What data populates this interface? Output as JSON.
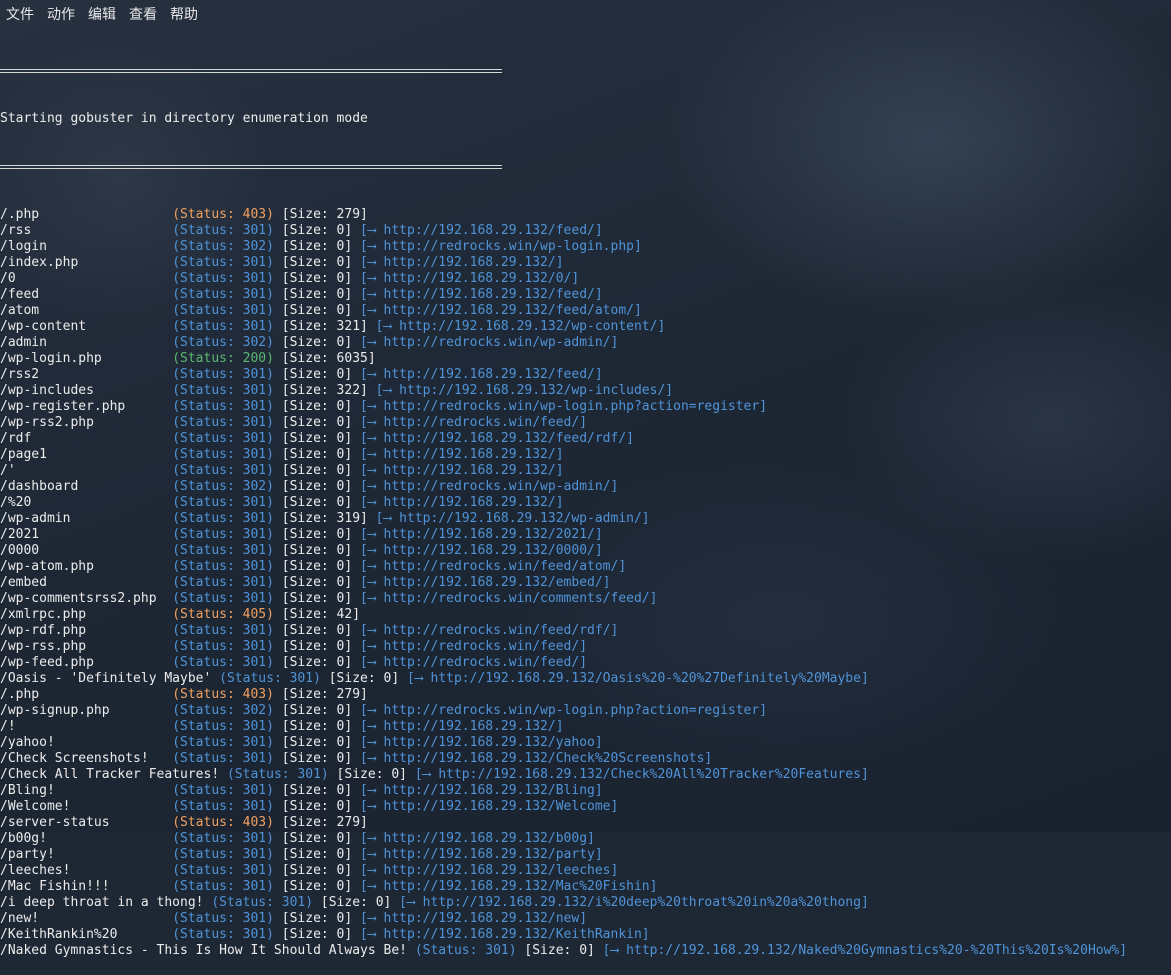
{
  "menubar": [
    "文件",
    "动作",
    "编辑",
    "查看",
    "帮助"
  ],
  "banner": "Starting gobuster in directory enumeration mode",
  "rows": [
    {
      "path": "/.php",
      "status": "403",
      "size": "279",
      "redirect": ""
    },
    {
      "path": "/rss",
      "status": "301",
      "size": "0",
      "redirect": "http://192.168.29.132/feed/"
    },
    {
      "path": "/login",
      "status": "302",
      "size": "0",
      "redirect": "http://redrocks.win/wp-login.php"
    },
    {
      "path": "/index.php",
      "status": "301",
      "size": "0",
      "redirect": "http://192.168.29.132/"
    },
    {
      "path": "/0",
      "status": "301",
      "size": "0",
      "redirect": "http://192.168.29.132/0/"
    },
    {
      "path": "/feed",
      "status": "301",
      "size": "0",
      "redirect": "http://192.168.29.132/feed/"
    },
    {
      "path": "/atom",
      "status": "301",
      "size": "0",
      "redirect": "http://192.168.29.132/feed/atom/"
    },
    {
      "path": "/wp-content",
      "status": "301",
      "size": "321",
      "redirect": "http://192.168.29.132/wp-content/"
    },
    {
      "path": "/admin",
      "status": "302",
      "size": "0",
      "redirect": "http://redrocks.win/wp-admin/"
    },
    {
      "path": "/wp-login.php",
      "status": "200",
      "size": "6035",
      "redirect": ""
    },
    {
      "path": "/rss2",
      "status": "301",
      "size": "0",
      "redirect": "http://192.168.29.132/feed/"
    },
    {
      "path": "/wp-includes",
      "status": "301",
      "size": "322",
      "redirect": "http://192.168.29.132/wp-includes/"
    },
    {
      "path": "/wp-register.php",
      "status": "301",
      "size": "0",
      "redirect": "http://redrocks.win/wp-login.php?action=register"
    },
    {
      "path": "/wp-rss2.php",
      "status": "301",
      "size": "0",
      "redirect": "http://redrocks.win/feed/"
    },
    {
      "path": "/rdf",
      "status": "301",
      "size": "0",
      "redirect": "http://192.168.29.132/feed/rdf/"
    },
    {
      "path": "/page1",
      "status": "301",
      "size": "0",
      "redirect": "http://192.168.29.132/"
    },
    {
      "path": "/'",
      "status": "301",
      "size": "0",
      "redirect": "http://192.168.29.132/"
    },
    {
      "path": "/dashboard",
      "status": "302",
      "size": "0",
      "redirect": "http://redrocks.win/wp-admin/"
    },
    {
      "path": "/%20",
      "status": "301",
      "size": "0",
      "redirect": "http://192.168.29.132/"
    },
    {
      "path": "/wp-admin",
      "status": "301",
      "size": "319",
      "redirect": "http://192.168.29.132/wp-admin/"
    },
    {
      "path": "/2021",
      "status": "301",
      "size": "0",
      "redirect": "http://192.168.29.132/2021/"
    },
    {
      "path": "/0000",
      "status": "301",
      "size": "0",
      "redirect": "http://192.168.29.132/0000/"
    },
    {
      "path": "/wp-atom.php",
      "status": "301",
      "size": "0",
      "redirect": "http://redrocks.win/feed/atom/"
    },
    {
      "path": "/embed",
      "status": "301",
      "size": "0",
      "redirect": "http://192.168.29.132/embed/"
    },
    {
      "path": "/wp-commentsrss2.php",
      "status": "301",
      "size": "0",
      "redirect": "http://redrocks.win/comments/feed/"
    },
    {
      "path": "/xmlrpc.php",
      "status": "405",
      "size": "42",
      "redirect": ""
    },
    {
      "path": "/wp-rdf.php",
      "status": "301",
      "size": "0",
      "redirect": "http://redrocks.win/feed/rdf/"
    },
    {
      "path": "/wp-rss.php",
      "status": "301",
      "size": "0",
      "redirect": "http://redrocks.win/feed/"
    },
    {
      "path": "/wp-feed.php",
      "status": "301",
      "size": "0",
      "redirect": "http://redrocks.win/feed/"
    },
    {
      "path": "/Oasis - 'Definitely Maybe'",
      "status": "301",
      "size": "0",
      "redirect": "http://192.168.29.132/Oasis%20-%20%27Definitely%20Maybe"
    },
    {
      "path": "/.php",
      "status": "403",
      "size": "279",
      "redirect": ""
    },
    {
      "path": "/wp-signup.php",
      "status": "302",
      "size": "0",
      "redirect": "http://redrocks.win/wp-login.php?action=register"
    },
    {
      "path": "/!",
      "status": "301",
      "size": "0",
      "redirect": "http://192.168.29.132/"
    },
    {
      "path": "/yahoo!",
      "status": "301",
      "size": "0",
      "redirect": "http://192.168.29.132/yahoo"
    },
    {
      "path": "/Check Screenshots!",
      "status": "301",
      "size": "0",
      "redirect": "http://192.168.29.132/Check%20Screenshots"
    },
    {
      "path": "/Check All Tracker Features!",
      "status": "301",
      "size": "0",
      "redirect": "http://192.168.29.132/Check%20All%20Tracker%20Features"
    },
    {
      "path": "/Bling!",
      "status": "301",
      "size": "0",
      "redirect": "http://192.168.29.132/Bling"
    },
    {
      "path": "/Welcome!",
      "status": "301",
      "size": "0",
      "redirect": "http://192.168.29.132/Welcome"
    },
    {
      "path": "/server-status",
      "status": "403",
      "size": "279",
      "redirect": ""
    },
    {
      "path": "/b00g!",
      "status": "301",
      "size": "0",
      "redirect": "http://192.168.29.132/b00g"
    },
    {
      "path": "/party!",
      "status": "301",
      "size": "0",
      "redirect": "http://192.168.29.132/party"
    },
    {
      "path": "/leeches!",
      "status": "301",
      "size": "0",
      "redirect": "http://192.168.29.132/leeches"
    },
    {
      "path": "/Mac Fishin!!!",
      "status": "301",
      "size": "0",
      "redirect": "http://192.168.29.132/Mac%20Fishin"
    },
    {
      "path": "/i deep throat in a thong!",
      "status": "301",
      "size": "0",
      "redirect": "http://192.168.29.132/i%20deep%20throat%20in%20a%20thong"
    },
    {
      "path": "/new!",
      "status": "301",
      "size": "0",
      "redirect": "http://192.168.29.132/new"
    },
    {
      "path": "/KeithRankin%20",
      "status": "301",
      "size": "0",
      "redirect": "http://192.168.29.132/KeithRankin"
    },
    {
      "path": "/Naked Gymnastics - This Is How It Should Always Be!",
      "status": "301",
      "size": "0",
      "redirect": "http://192.168.29.132/Naked%20Gymnastics%20-%20This%20Is%20How%"
    }
  ],
  "colors": {
    "status_3xx": "#4f93d8",
    "status_2xx": "#5ab870",
    "status_4xx": "#f0a060",
    "redirect": "#4f93d8",
    "text": "#ececec"
  }
}
